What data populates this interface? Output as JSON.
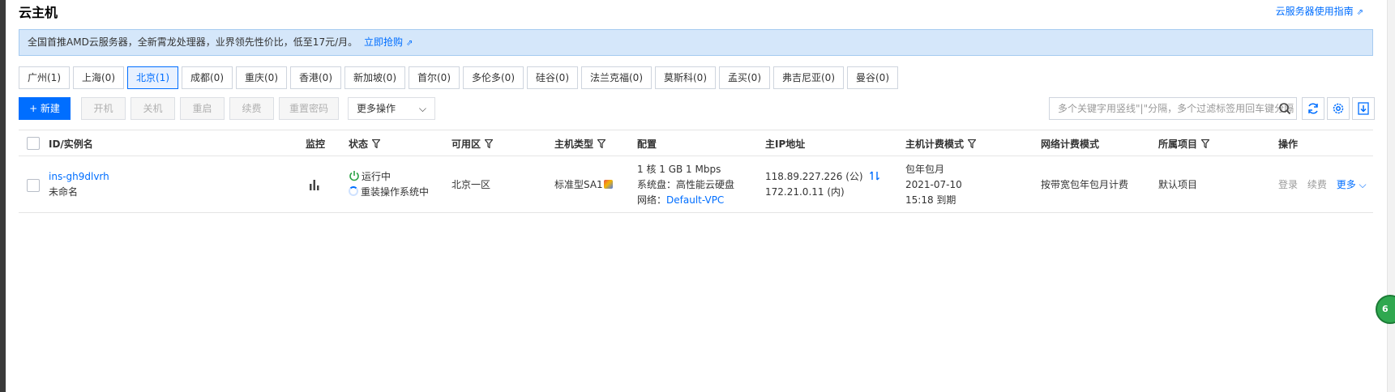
{
  "page": {
    "title": "云主机",
    "guide_link": "云服务器使用指南"
  },
  "notice": {
    "text": "全国首推AMD云服务器，全新霄龙处理器，业界领先性价比，低至17元/月。",
    "link": "立即抢购"
  },
  "regions": [
    {
      "label": "广州(1)",
      "active": false
    },
    {
      "label": "上海(0)",
      "active": false
    },
    {
      "label": "北京(1)",
      "active": true
    },
    {
      "label": "成都(0)",
      "active": false
    },
    {
      "label": "重庆(0)",
      "active": false
    },
    {
      "label": "香港(0)",
      "active": false
    },
    {
      "label": "新加坡(0)",
      "active": false
    },
    {
      "label": "首尔(0)",
      "active": false
    },
    {
      "label": "多伦多(0)",
      "active": false
    },
    {
      "label": "硅谷(0)",
      "active": false
    },
    {
      "label": "法兰克福(0)",
      "active": false
    },
    {
      "label": "莫斯科(0)",
      "active": false
    },
    {
      "label": "孟买(0)",
      "active": false
    },
    {
      "label": "弗吉尼亚(0)",
      "active": false
    },
    {
      "label": "曼谷(0)",
      "active": false
    }
  ],
  "toolbar": {
    "new_label": "+ 新建",
    "start_label": "开机",
    "stop_label": "关机",
    "restart_label": "重启",
    "renew_label": "续费",
    "reset_password_label": "重置密码",
    "more_actions_label": "更多操作",
    "search_placeholder": "多个关键字用竖线\"|\"分隔，多个过滤标签用回车键分隔"
  },
  "table": {
    "headers": {
      "id": "ID/实例名",
      "monitor": "监控",
      "status": "状态",
      "zone": "可用区",
      "type": "主机类型",
      "config": "配置",
      "ip": "主IP地址",
      "billing": "主机计费模式",
      "net_billing": "网络计费模式",
      "project": "所属项目",
      "actions": "操作"
    },
    "rows": [
      {
        "id": "ins-gh9dlvrh",
        "name": "未命名",
        "status_running": "运行中",
        "status_task": "重装操作系统中",
        "zone": "北京一区",
        "type": "标准型SA1",
        "config_spec": "1 核 1 GB 1 Mbps",
        "config_disk": "系统盘：高性能云硬盘",
        "config_net_label": "网络：",
        "config_net_link": "Default-VPC",
        "public_ip": "118.89.227.226 (公)",
        "private_ip": "172.21.0.11 (内)",
        "billing_mode": "包年包月",
        "billing_date": "2021-07-10",
        "billing_expire": "15:18 到期",
        "net_billing": "按带宽包年包月计费",
        "project": "默认项目",
        "action_login": "登录",
        "action_renew": "续费",
        "action_more": "更多"
      }
    ]
  },
  "side_badge": "6",
  "colors": {
    "accent": "#006eff",
    "notice_bg": "#d5e7fa",
    "running": "#2ba245"
  }
}
